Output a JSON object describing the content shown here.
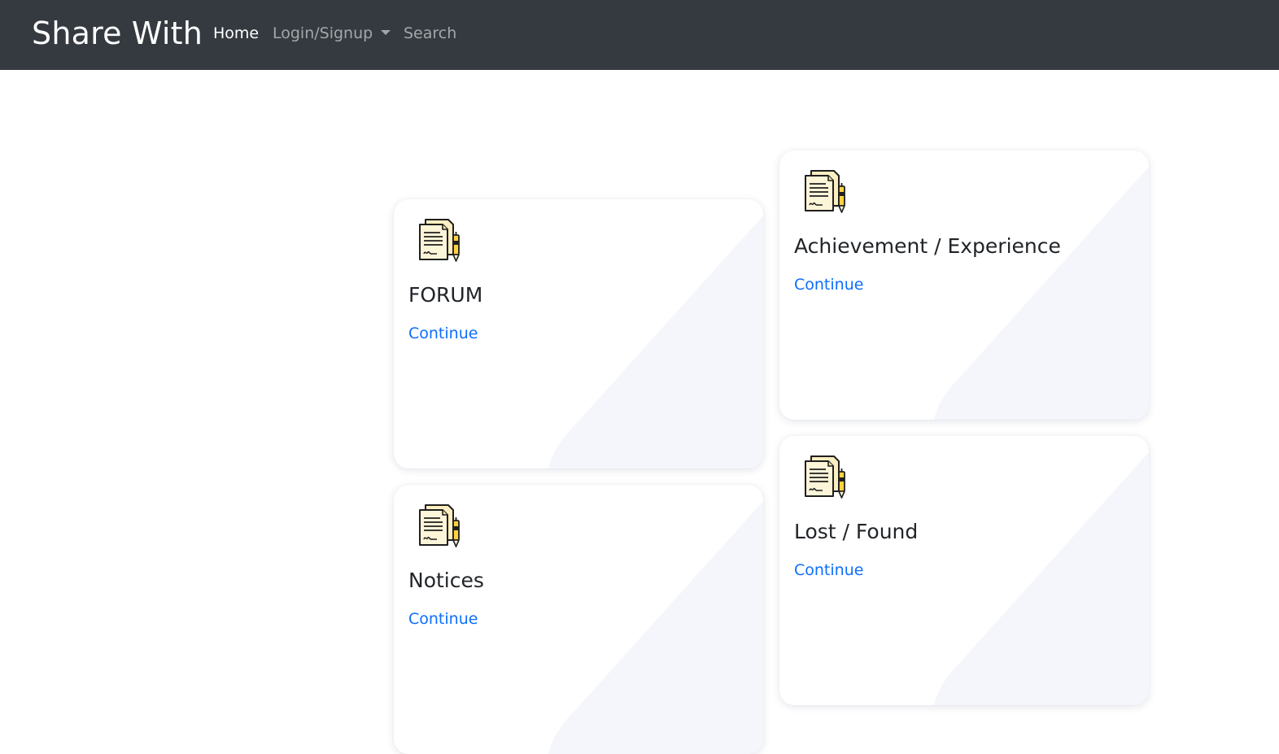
{
  "navbar": {
    "brand": "Share With",
    "links": [
      {
        "label": "Home",
        "active": true
      },
      {
        "label": "Login/Signup",
        "dropdown": true
      },
      {
        "label": "Search"
      }
    ]
  },
  "cards": [
    {
      "title": "FORUM",
      "link": "Continue",
      "icon": "document-pen-icon"
    },
    {
      "title": "Achievement / Experience",
      "link": "Continue",
      "icon": "document-pen-icon"
    },
    {
      "title": "Notices",
      "link": "Continue",
      "icon": "document-pen-icon"
    },
    {
      "title": "Lost / Found",
      "link": "Continue",
      "icon": "document-pen-icon"
    }
  ],
  "colors": {
    "navbar": "#343a40",
    "link": "#0d6efd",
    "card_accent": "#f5f6fb"
  }
}
